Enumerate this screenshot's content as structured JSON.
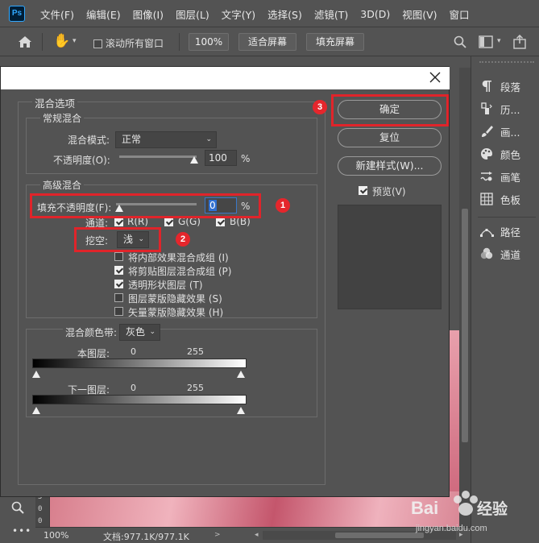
{
  "app": {
    "logo": "Ps",
    "menu": [
      "文件(F)",
      "编辑(E)",
      "图像(I)",
      "图层(L)",
      "文字(Y)",
      "选择(S)",
      "滤镜(T)",
      "3D(D)",
      "视图(V)",
      "窗口"
    ]
  },
  "options_bar": {
    "scroll_all_windows": "滚动所有窗口",
    "zoom_btn": "100%",
    "fit_screen": "适合屏幕",
    "fill_screen": "填充屏幕"
  },
  "ruler": {
    "ticks": [
      "5",
      "0",
      "0"
    ]
  },
  "status": {
    "zoom": "100%",
    "doc": "文档:977.1K/977.1K"
  },
  "right_panel": {
    "items": [
      {
        "icon": "paragraph-icon",
        "label": "段落"
      },
      {
        "icon": "history-icon",
        "label": "历..."
      },
      {
        "icon": "brush-icon",
        "label": "画..."
      },
      {
        "icon": "color-palette-icon",
        "label": "颜色"
      },
      {
        "icon": "brush-settings-icon",
        "label": "画笔"
      },
      {
        "icon": "swatches-grid-icon",
        "label": "色板"
      },
      {
        "icon": "paths-icon",
        "label": "路径"
      },
      {
        "icon": "channels-icon",
        "label": "通道"
      }
    ]
  },
  "dialog": {
    "section_blend_options": "混合选项",
    "general_blending": "常规混合",
    "blend_mode_label": "混合模式:",
    "blend_mode_value": "正常",
    "opacity_label": "不透明度(O):",
    "opacity_value": "100",
    "opacity_unit": "%",
    "advanced_blending": "高级混合",
    "fill_opacity_label": "填充不透明度(F):",
    "fill_opacity_value": "0",
    "fill_opacity_unit": "%",
    "channels_label": "通道:",
    "channel_r": "R(R)",
    "channel_g": "G(G)",
    "channel_b": "B(B)",
    "knockout_label": "挖空:",
    "knockout_value": "浅",
    "options": [
      {
        "label": "将内部效果混合成组 (I)",
        "checked": false
      },
      {
        "label": "将剪贴图层混合成组 (P)",
        "checked": true
      },
      {
        "label": "透明形状图层 (T)",
        "checked": true
      },
      {
        "label": "图层蒙版隐藏效果 (S)",
        "checked": false
      },
      {
        "label": "矢量蒙版隐藏效果 (H)",
        "checked": false
      }
    ],
    "blend_if_label": "混合颜色带:",
    "blend_if_value": "灰色",
    "this_layer_label": "本图层:",
    "this_layer_min": "0",
    "this_layer_max": "255",
    "underlying_label": "下一图层:",
    "underlying_min": "0",
    "underlying_max": "255",
    "ok": "确定",
    "reset": "复位",
    "new_style": "新建样式(W)...",
    "preview_label": "预览(V)",
    "preview_checked": true
  },
  "annotations": {
    "badge_1": "1",
    "badge_2": "2",
    "badge_3": "3",
    "color": "#e0242a"
  },
  "watermark": {
    "brand": "Baidu经验",
    "url": "jingyan.baidu.com"
  }
}
